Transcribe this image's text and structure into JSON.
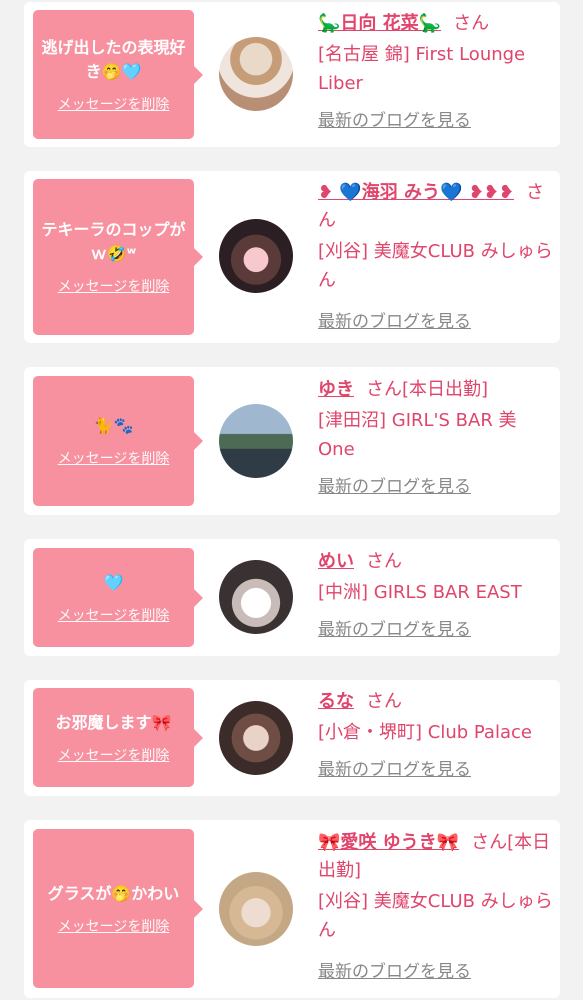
{
  "cards": [
    {
      "message": "逃げ出したの表現好き🤭🩵",
      "delete_label": "メッセージを削除",
      "name": "🦕日向 花菜🦕",
      "suffix": "さん",
      "shop": "[名古屋 錦] First Lounge Liber",
      "blog_label": "最新のブログを見る"
    },
    {
      "message": "テキーラのコップがｗ🤣ʷ",
      "delete_label": "メッセージを削除",
      "name": "❥ 💙海羽 みう💙 ❥❥❥",
      "suffix": "さん",
      "shop": "[刈谷] 美魔女CLUB みしゅらん",
      "blog_label": "最新のブログを見る"
    },
    {
      "message": "🐈🐾",
      "delete_label": "メッセージを削除",
      "name": "ゆき",
      "suffix": "さん[本日出勤]",
      "shop": "[津田沼] GIRL'S BAR 美 One",
      "blog_label": "最新のブログを見る"
    },
    {
      "message": "🩵",
      "delete_label": "メッセージを削除",
      "name": "めい",
      "suffix": "さん",
      "shop": "[中洲] GIRLS BAR EAST",
      "blog_label": "最新のブログを見る"
    },
    {
      "message": "お邪魔します🎀",
      "delete_label": "メッセージを削除",
      "name": "るな",
      "suffix": "さん",
      "shop": "[小倉・堺町] Club Palace",
      "blog_label": "最新のブログを見る"
    },
    {
      "message": "グラスが🤭かわい",
      "delete_label": "メッセージを削除",
      "name": "🎀愛咲 ゆうき🎀",
      "suffix": "さん[本日出勤]",
      "shop": "[刈谷] 美魔女CLUB みしゅらん",
      "blog_label": "最新のブログを見る"
    }
  ],
  "colors": {
    "page_bg": "#f2f2f2",
    "bubble": "#f7919f",
    "accent": "#e0456b",
    "link_gray": "#888888"
  }
}
